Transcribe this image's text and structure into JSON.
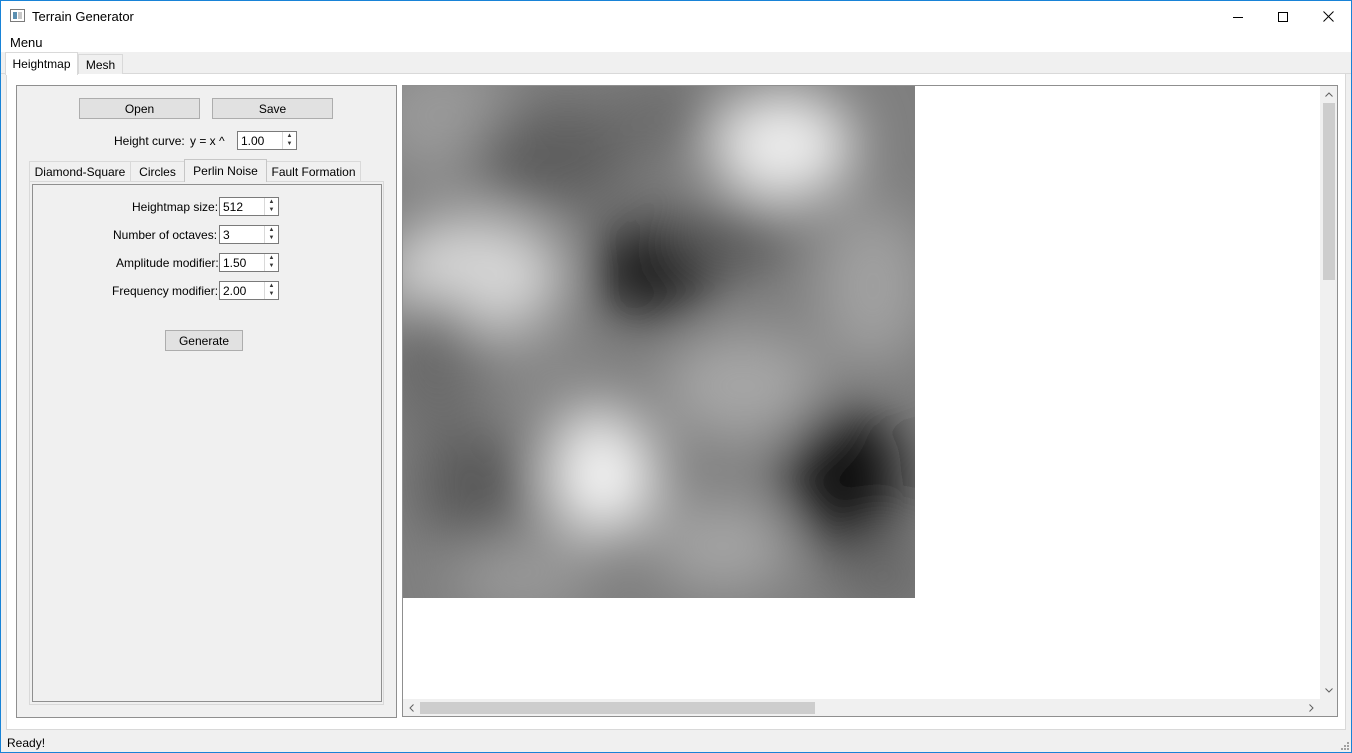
{
  "window": {
    "title": "Terrain Generator",
    "controls": [
      "minimize-icon",
      "maximize-icon",
      "close-icon"
    ]
  },
  "menubar": {
    "menu_label": "Menu"
  },
  "main_tabs": [
    {
      "label": "Heightmap",
      "active": true
    },
    {
      "label": "Mesh",
      "active": false
    }
  ],
  "toolbar": {
    "open_label": "Open",
    "save_label": "Save"
  },
  "height_curve": {
    "label": "Height curve:",
    "formula": "y = x ^",
    "value": "1.00"
  },
  "algorithm_tabs": [
    {
      "label": "Diamond-Square",
      "active": false
    },
    {
      "label": "Circles",
      "active": false
    },
    {
      "label": "Perlin Noise",
      "active": true
    },
    {
      "label": "Fault Formation",
      "active": false
    }
  ],
  "perlin": {
    "fields": [
      {
        "label": "Heightmap size:",
        "value": "512"
      },
      {
        "label": "Number of octaves:",
        "value": "3"
      },
      {
        "label": "Amplitude modifier:",
        "value": "1.50"
      },
      {
        "label": "Frequency modifier:",
        "value": "2.00"
      }
    ],
    "generate_label": "Generate"
  },
  "preview": {
    "image": "perlin-noise-heightmap"
  },
  "statusbar": {
    "text": "Ready!"
  },
  "colors": {
    "window_border": "#1883d7",
    "chrome": "#f0f0f0",
    "button": "#e1e1e1",
    "scroll_thumb": "#cdcdcd"
  }
}
